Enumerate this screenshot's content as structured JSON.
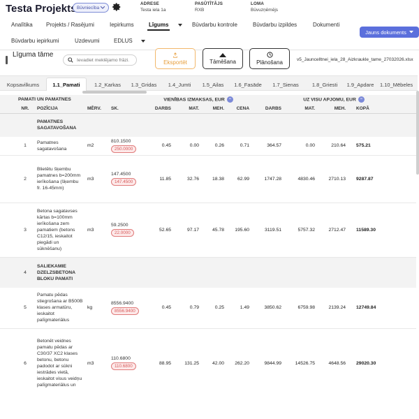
{
  "header": {
    "project_title": "Testa Projekts",
    "status_badge": "Būvniecība",
    "address_key": "ADRESE",
    "address_val": "Testa iela 1a",
    "client_key": "PASŪTĪTĀJS",
    "client_val": "RXB",
    "role_key": "LOMA",
    "role_val": "Būvuzņēmējs"
  },
  "nav": {
    "items": [
      "Analītika",
      "Projekts / Rasējumi",
      "Iepirkums",
      "Līgums",
      "Būvdarbu kontrole",
      "Būvdarbu izpildes",
      "Dokumenti"
    ],
    "items_row2": [
      "Būvdarbu iepirkumi",
      "Uzdevumi",
      "EDLUS"
    ],
    "new_doc": "Jauns dokuments"
  },
  "toolbar": {
    "title": "Līguma tāme",
    "search_placeholder": "Ievadiet meklējamo frāzi.",
    "export": "Eksportēt",
    "smeta": "Tāmēšana",
    "plan": "Plānošana",
    "filename": "v5_Jauncelltnei_iela_28_Aizkraukle_tame_27032026.xlsx"
  },
  "tabs": [
    "Kopsavilkums",
    "1.1_Pamati",
    "1.2_Karkas",
    "1.3_Gridas",
    "1.4_Jumti",
    "1.5_Ailas",
    "1.6_Fasāde",
    "1.7_Sienas",
    "1.8_Griesti",
    "1.9_Apdare",
    "1.10_Mēbeles"
  ],
  "table": {
    "group_title": "PAMATI UN PAMATNES",
    "unit_cost_group": "VIENĪBAS IZMAKSAS, EUR",
    "total_group": "UZ VISU APJOMU, EUR",
    "cols": [
      "NR.",
      "POZĪCIJA",
      "MĒRV.",
      "SK.",
      "DARBS",
      "MAT.",
      "MEH.",
      "CENA",
      "DARBS",
      "MAT.",
      "MEH.",
      "KOPĀ"
    ],
    "section1": "PAMATNES SAGATAVOŠANA",
    "rows": [
      {
        "nr": "1",
        "name": "Pamatnes sagatavošana",
        "unit": "m2",
        "qty": "810.1500",
        "qty_tag": "250.0000",
        "d": "0.45",
        "m": "0.00",
        "h": "0.26",
        "c": "0.71",
        "td": "364.57",
        "tm": "0.00",
        "th": "210.64",
        "tot": "575.21"
      },
      {
        "nr": "2",
        "name": "Blietētu šķembu pamatnes b=200mm ierīkošana (šķembu fr. 16-45mm)",
        "unit": "m3",
        "qty": "147.4500",
        "qty_tag": "147.4500",
        "d": "11.85",
        "m": "32.76",
        "h": "18.38",
        "c": "62.99",
        "td": "1747.28",
        "tm": "4830.46",
        "th": "2710.13",
        "tot": "9287.87"
      },
      {
        "nr": "3",
        "name": "Betona sagatavses kārtas b=100mm ierīkošana zem pamatiem (betons C12/15, ieskaitot piegādi un sūknēšanu)",
        "unit": "m3",
        "qty": "59.2500",
        "qty_tag": "22.0000",
        "d": "52.65",
        "m": "97.17",
        "h": "45.78",
        "c": "195.60",
        "td": "3119.51",
        "tm": "5757.32",
        "th": "2712.47",
        "tot": "11589.30"
      }
    ],
    "section2_nr": "4",
    "section2": "SALIEKAMIE DZELZSBETONA BLOKU PAMATI",
    "rows2": [
      {
        "nr": "5",
        "name": "Pamatu pēdas stiegrošana ar B500B klases armatūru, ieskaitot palīgmateriālus",
        "unit": "kg",
        "qty": "8556.9400",
        "qty_tag": "8556.9400",
        "d": "0.45",
        "m": "0.79",
        "h": "0.25",
        "c": "1.49",
        "td": "3850.62",
        "tm": "6759.98",
        "th": "2139.24",
        "tot": "12749.84"
      },
      {
        "nr": "6",
        "name": "Betonēt veidnes pamatu pēdas ar C30/37 XC2 klases betonu, betonu padodot ar sūkni iestrādes vietā, ieskaitot visus veidņu palīgmateriālus un",
        "unit": "m3",
        "qty": "110.6800",
        "qty_tag": "110.6800",
        "d": "88.95",
        "m": "131.25",
        "h": "42.00",
        "c": "262.20",
        "td": "9844.99",
        "tm": "14526.75",
        "th": "4648.56",
        "tot": "29020.30"
      }
    ]
  }
}
